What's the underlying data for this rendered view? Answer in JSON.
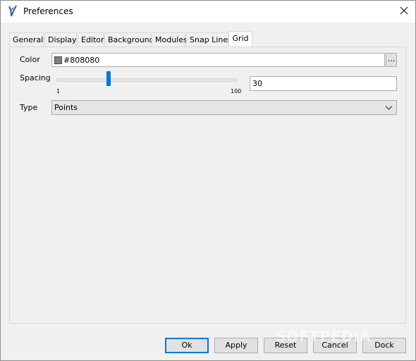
{
  "window": {
    "title": "Preferences"
  },
  "tabs": [
    {
      "label": "General"
    },
    {
      "label": "Display"
    },
    {
      "label": "Editor"
    },
    {
      "label": "Background"
    },
    {
      "label": "Modules"
    },
    {
      "label": "Snap Lines"
    },
    {
      "label": "Grid",
      "active": true
    }
  ],
  "grid": {
    "color_label": "Color",
    "color_value": "#808080",
    "color_swatch": "#808080",
    "browse_label": "...",
    "spacing_label": "Spacing",
    "spacing_min": "1",
    "spacing_max": "100",
    "spacing_value": "30",
    "type_label": "Type",
    "type_value": "Points"
  },
  "buttons": {
    "ok": "Ok",
    "apply": "Apply",
    "reset": "Reset",
    "cancel": "Cancel",
    "dock": "Dock"
  },
  "watermark": "SOFTPEDIA",
  "icons": [
    "app-icon",
    "close-icon",
    "chevron-down-icon"
  ],
  "accent_color": "#0078d7"
}
